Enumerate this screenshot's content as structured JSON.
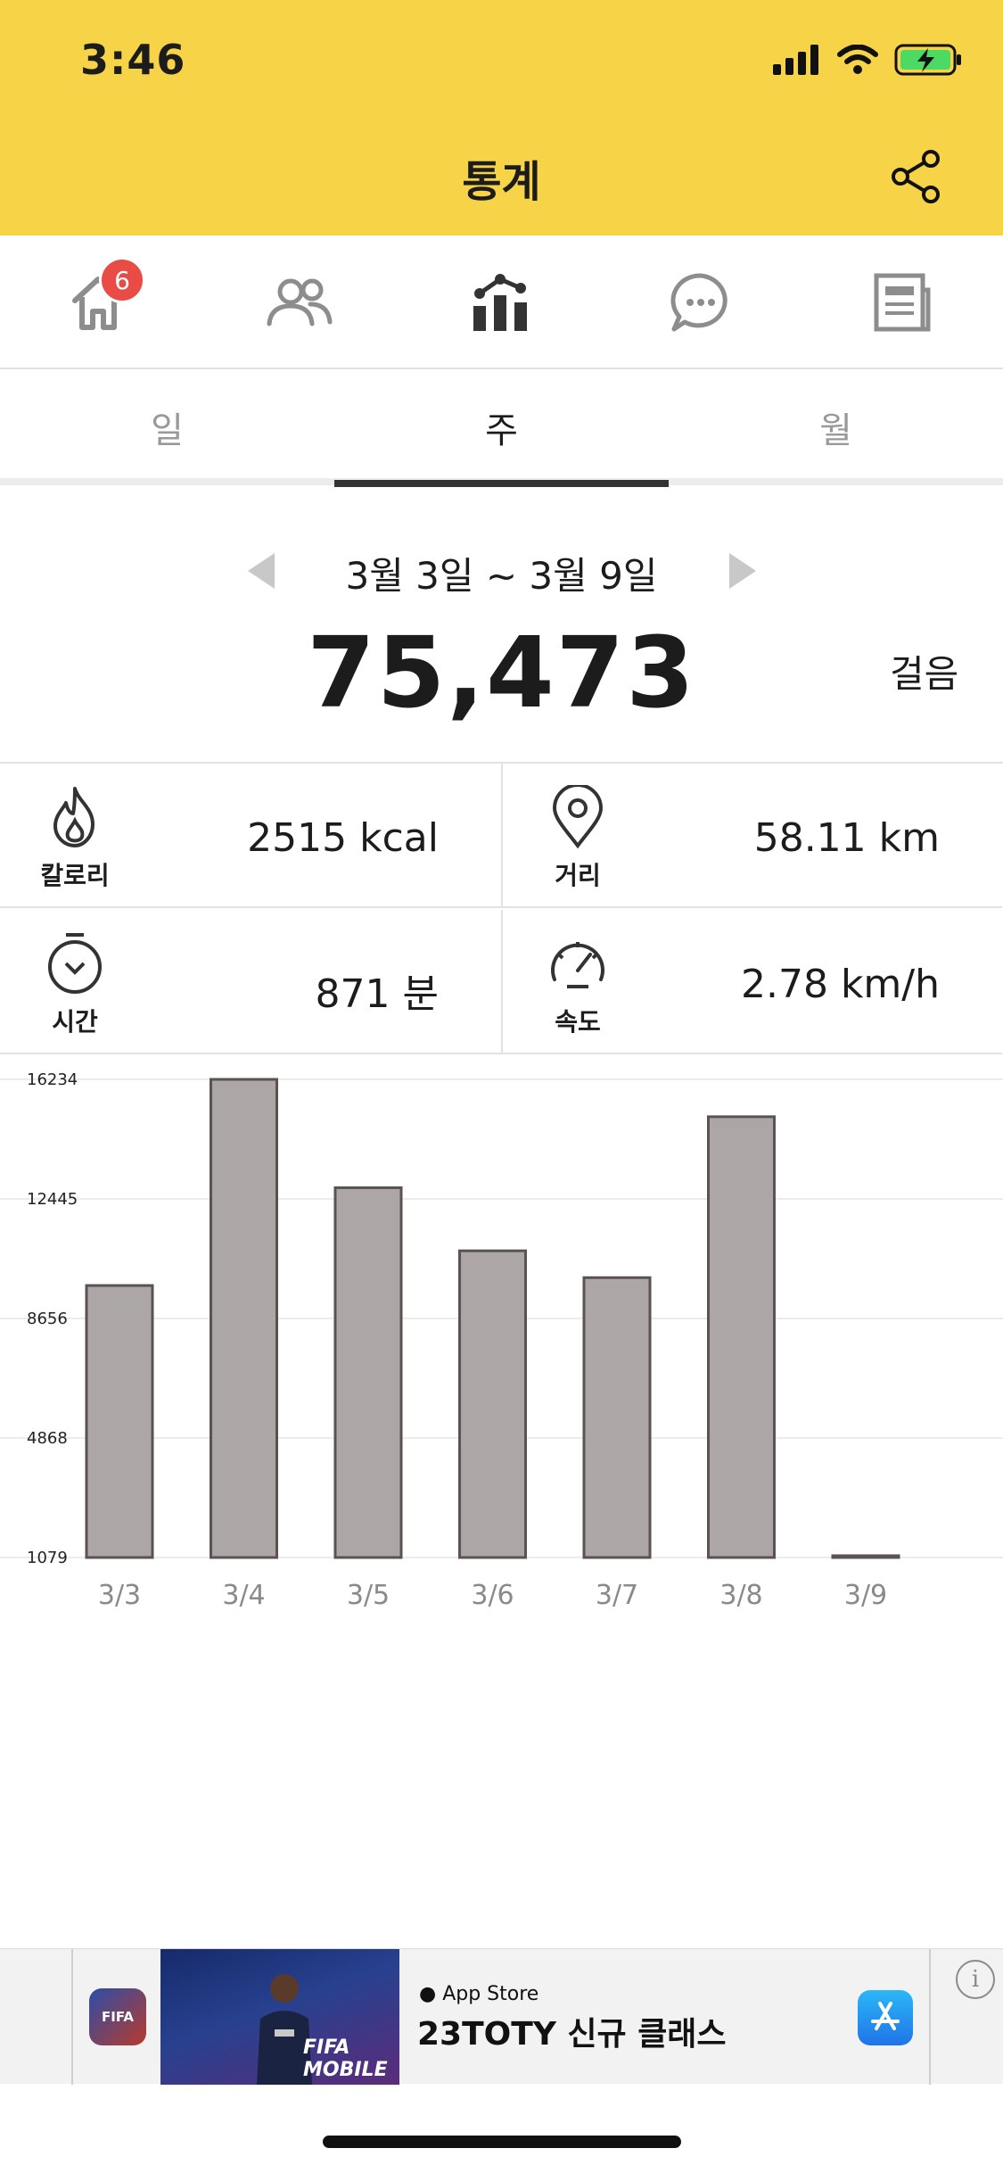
{
  "status_bar": {
    "time": "3:46"
  },
  "header": {
    "title": "통계"
  },
  "nav": {
    "home_badge": "6",
    "items": [
      "home-icon",
      "friends-icon",
      "stats-icon",
      "chat-icon",
      "news-icon"
    ]
  },
  "tabs": [
    {
      "label": "일",
      "active": false
    },
    {
      "label": "주",
      "active": true
    },
    {
      "label": "월",
      "active": false
    }
  ],
  "summary": {
    "range": "3월 3일 ~ 3월 9일",
    "total": "75,473",
    "unit": "걸음"
  },
  "stats": {
    "calories": {
      "label": "칼로리",
      "value": "2515 kcal",
      "icon": "flame-icon"
    },
    "distance": {
      "label": "거리",
      "value": "58.11 km",
      "icon": "location-pin-icon"
    },
    "time": {
      "label": "시간",
      "value": "871 분",
      "icon": "stopwatch-icon"
    },
    "speed": {
      "label": "속도",
      "value": "2.78 km/h",
      "icon": "speedometer-icon"
    }
  },
  "chart_data": {
    "type": "bar",
    "categories": [
      "3/3",
      "3/4",
      "3/5",
      "3/6",
      "3/7",
      "3/8",
      "3/9"
    ],
    "values": [
      9700,
      16234,
      12800,
      10800,
      9950,
      15050,
      1079
    ],
    "yticks": [
      1079,
      4868,
      8656,
      12445,
      16234
    ],
    "ylim": [
      1079,
      16234
    ],
    "grid": true,
    "bar_color": "#aca6a6",
    "bar_stroke": "#5b5252"
  },
  "ad": {
    "app_icon_text": "FIFA",
    "banner_text": "FIFA MOBILE",
    "store": "App Store",
    "headline": "23TOTY 신규 클래스"
  },
  "colors": {
    "header": "#f6d347",
    "badge": "#e94b45"
  }
}
